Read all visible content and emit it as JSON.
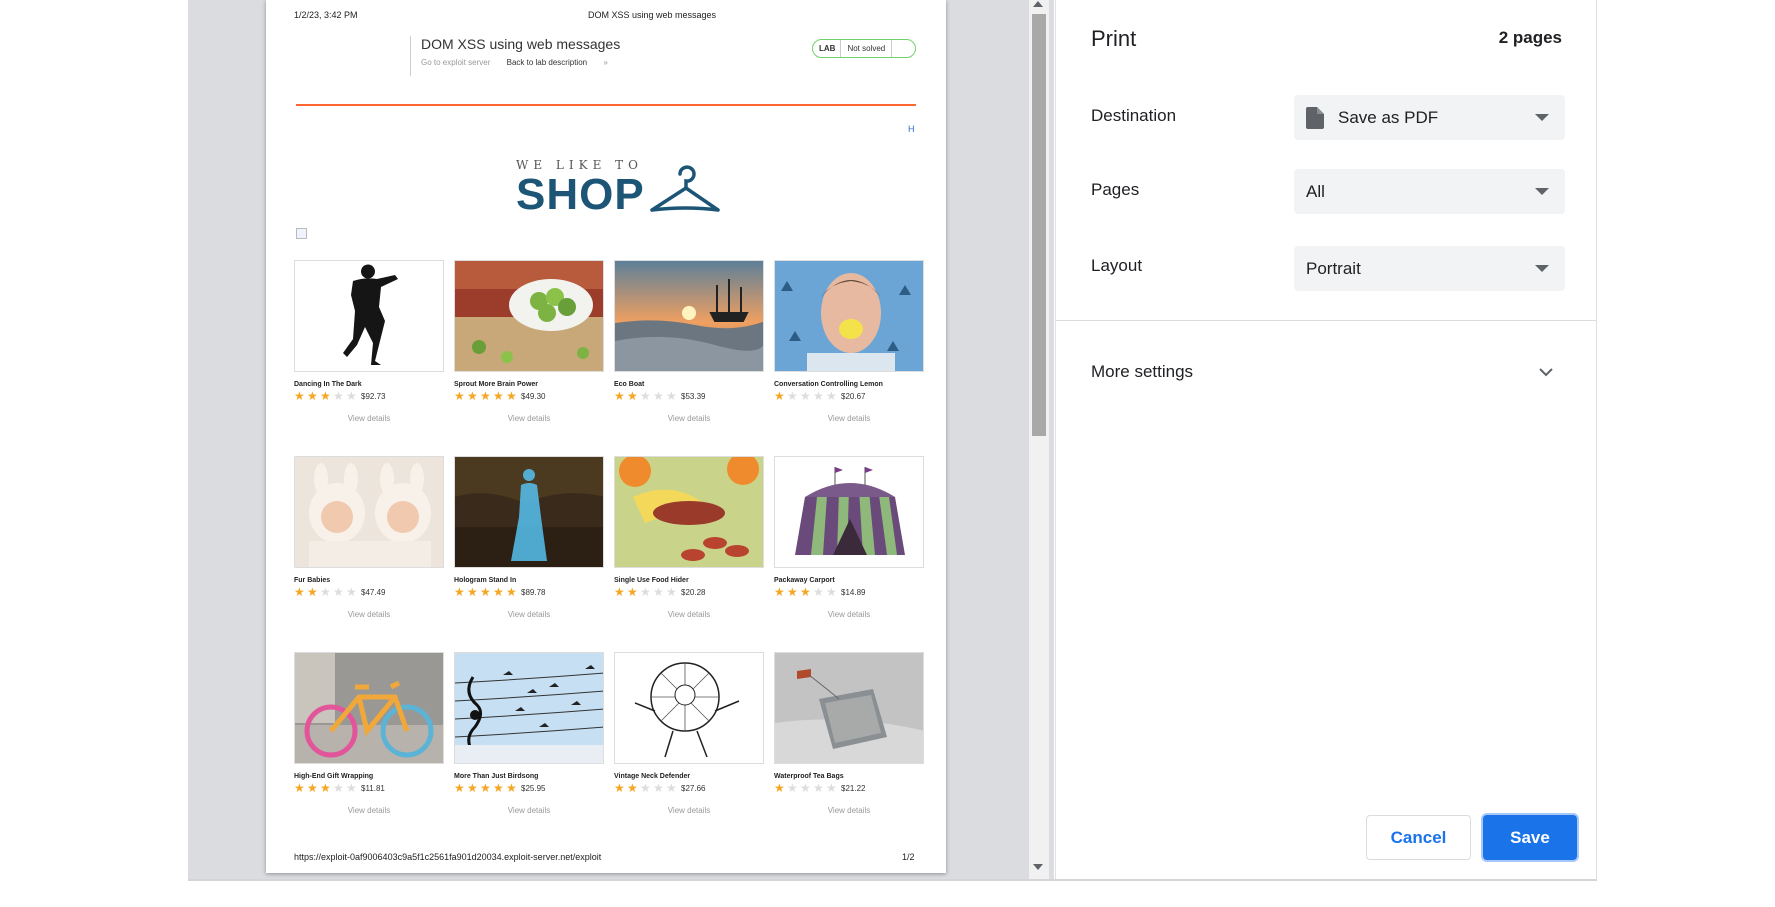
{
  "preview": {
    "header_date": "1/2/23, 3:42 PM",
    "header_title": "DOM XSS using web messages",
    "lab_title": "DOM XSS using web messages",
    "exploit_link": "Go to exploit server",
    "back_link": "Back to lab description",
    "back_link_glyph": "»",
    "lab_badge": "LAB",
    "lab_status": "Not solved",
    "h_mark": "H",
    "logo_tagline": "WE LIKE TO",
    "logo_word": "SHOP",
    "view_details_label": "View details",
    "footer_url": "https://exploit-0af9006403c9a5f1c2561fa901d20034.exploit-server.net/exploit",
    "footer_page": "1/2",
    "products": [
      {
        "name": "Dancing In The Dark",
        "stars": 3,
        "price": "$92.73",
        "image": "silhouette-dancer-image"
      },
      {
        "name": "Sprout More Brain Power",
        "stars": 5,
        "price": "$49.30",
        "image": "brussels-sprouts-image"
      },
      {
        "name": "Eco Boat",
        "stars": 2,
        "price": "$53.39",
        "image": "ship-sunset-image"
      },
      {
        "name": "Conversation Controlling Lemon",
        "stars": 1,
        "price": "$20.67",
        "image": "man-lemon-image"
      },
      {
        "name": "Fur Babies",
        "stars": 2,
        "price": "$47.49",
        "image": "babies-bunny-hats-image"
      },
      {
        "name": "Hologram Stand In",
        "stars": 5,
        "price": "$89.78",
        "image": "hologram-woman-image"
      },
      {
        "name": "Single Use Food Hider",
        "stars": 2,
        "price": "$20.28",
        "image": "sausage-banana-image"
      },
      {
        "name": "Packaway Carport",
        "stars": 3,
        "price": "$14.89",
        "image": "striped-tent-image"
      },
      {
        "name": "High-End Gift Wrapping",
        "stars": 3,
        "price": "$11.81",
        "image": "knitted-bicycle-image"
      },
      {
        "name": "More Than Just Birdsong",
        "stars": 5,
        "price": "$25.95",
        "image": "birds-music-wires-image"
      },
      {
        "name": "Vintage Neck Defender",
        "stars": 2,
        "price": "$27.66",
        "image": "neck-ruff-sketch-image"
      },
      {
        "name": "Waterproof Tea Bags",
        "stars": 1,
        "price": "$21.22",
        "image": "tea-bag-image"
      }
    ]
  },
  "panel": {
    "title": "Print",
    "page_count": "2 pages",
    "destination_label": "Destination",
    "destination_value": "Save as PDF",
    "pages_label": "Pages",
    "pages_value": "All",
    "layout_label": "Layout",
    "layout_value": "Portrait",
    "more_settings_label": "More settings",
    "cancel_label": "Cancel",
    "save_label": "Save"
  },
  "colors": {
    "accent": "#1a73e8",
    "orange_rule": "#ff6633",
    "star": "#f5a623",
    "lab_badge_border": "#70d16d",
    "logo": "#1c5575"
  }
}
